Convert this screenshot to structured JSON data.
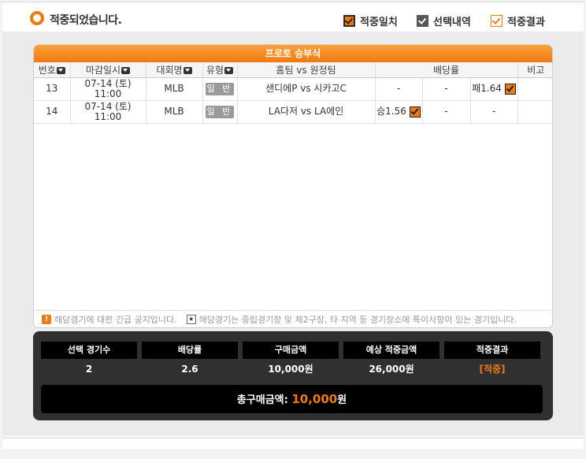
{
  "header": {
    "result_text": "적중되었습니다.",
    "legend": {
      "match": "적중일치",
      "selected": "선택내역",
      "result": "적중결과"
    }
  },
  "panel": {
    "title": "프로토 승부식",
    "columns": {
      "no": "번호",
      "deadline": "마감일시",
      "league": "대회명",
      "type": "유형",
      "teams": "홈팀 vs 원정팀",
      "odds": "배당률",
      "note": "비고"
    },
    "rows": [
      {
        "no": "13",
        "date": "07-14 (토)",
        "time": "11:00",
        "league": "MLB",
        "type": "일 반",
        "teams": "샌디에P vs 시카고C",
        "odd_win": "-",
        "odd_draw": "-",
        "odd_lose": "패1.64",
        "note": ""
      },
      {
        "no": "14",
        "date": "07-14 (토)",
        "time": "11:00",
        "league": "MLB",
        "type": "일 반",
        "teams": "LA다저 vs LA에인",
        "odd_win": "승1.56",
        "odd_draw": "-",
        "odd_lose": "-",
        "note": ""
      }
    ],
    "notice_urgent": "해당경기에 대한 긴급 공지입니다.",
    "notice_special": "해당경기는 중립경기장 및 제2구장, 타 지역 등 경기장소에 특이사항이 있는 경기입니다.",
    "notice_urgent_icon": "!",
    "notice_special_icon": "★"
  },
  "summary": {
    "labels": {
      "count": "선택 경기수",
      "odds": "배당률",
      "purchase": "구매금액",
      "expected": "예상 적중금액",
      "result": "적중결과"
    },
    "values": {
      "count": "2",
      "odds": "2.6",
      "purchase": "10,000원",
      "expected": "26,000원",
      "result": "[적중]"
    },
    "total_label": "총구매금액: ",
    "total_amount": "10,000",
    "total_unit": "원"
  },
  "colors": {
    "accent": "#f07a12",
    "dark": "#303030"
  }
}
